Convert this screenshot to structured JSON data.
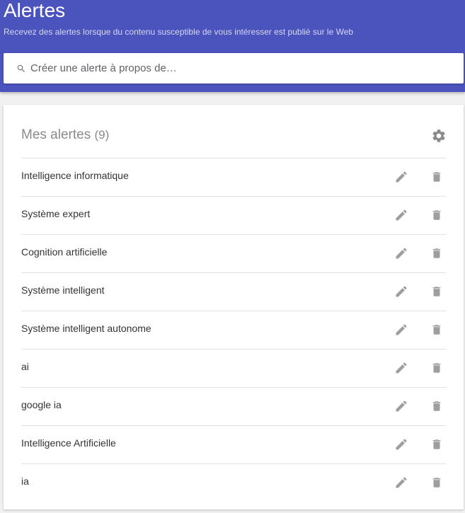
{
  "header": {
    "title": "Alertes",
    "subtitle": "Recevez des alertes lorsque du contenu susceptible de vous intéresser est publié sur le Web",
    "background_color": "#4b53bc"
  },
  "search": {
    "placeholder": "Créer une alerte à propos de…",
    "value": "",
    "icon": "search-icon"
  },
  "alerts": {
    "title": "Mes alertes",
    "count": "(9)",
    "settings_icon": "gear-icon",
    "items": [
      {
        "label": "Intelligence informatique",
        "edit_icon": "pencil-icon",
        "delete_icon": "trash-icon"
      },
      {
        "label": "Système expert",
        "edit_icon": "pencil-icon",
        "delete_icon": "trash-icon"
      },
      {
        "label": "Cognition artificielle",
        "edit_icon": "pencil-icon",
        "delete_icon": "trash-icon"
      },
      {
        "label": "Système intelligent",
        "edit_icon": "pencil-icon",
        "delete_icon": "trash-icon"
      },
      {
        "label": "Système intelligent autonome",
        "edit_icon": "pencil-icon",
        "delete_icon": "trash-icon"
      },
      {
        "label": "ai",
        "edit_icon": "pencil-icon",
        "delete_icon": "trash-icon"
      },
      {
        "label": "google ia",
        "edit_icon": "pencil-icon",
        "delete_icon": "trash-icon"
      },
      {
        "label": "Intelligence Artificielle",
        "edit_icon": "pencil-icon",
        "delete_icon": "trash-icon"
      },
      {
        "label": "ia",
        "edit_icon": "pencil-icon",
        "delete_icon": "trash-icon"
      }
    ]
  }
}
